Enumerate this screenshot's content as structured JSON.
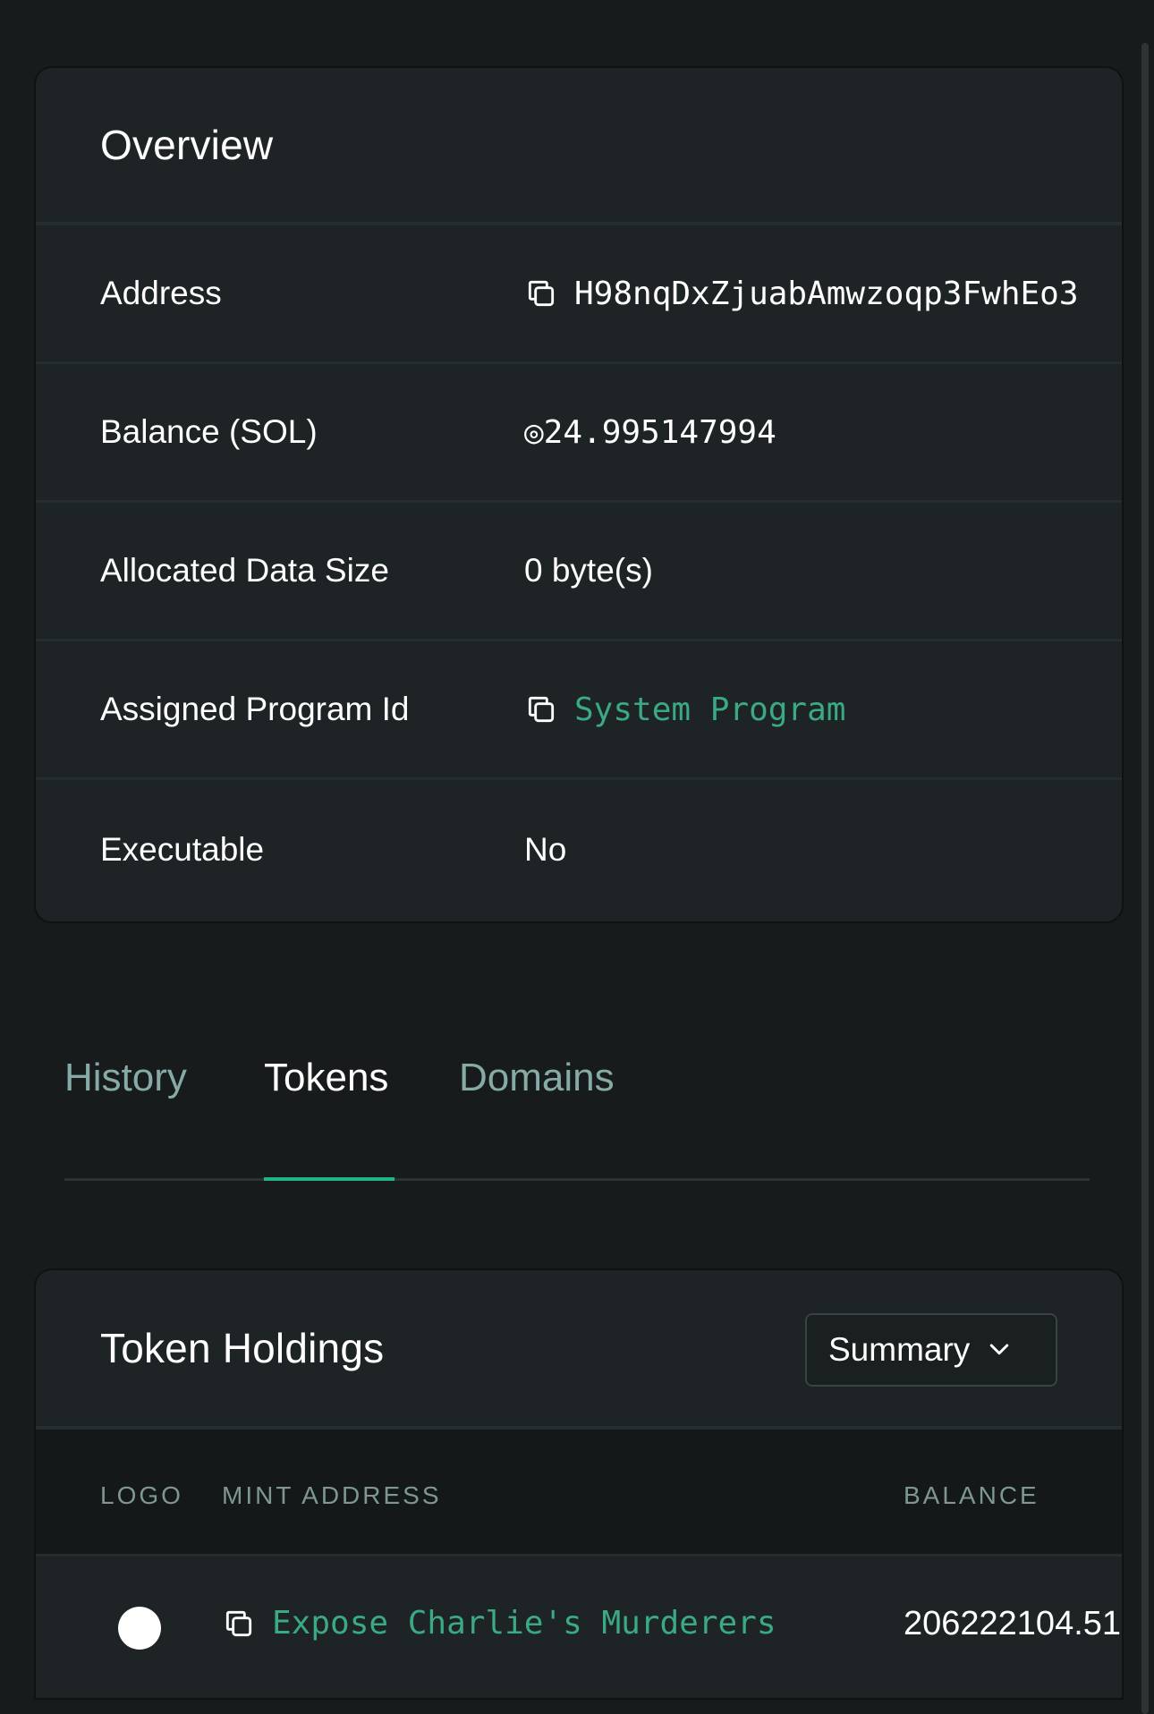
{
  "overview": {
    "title": "Overview",
    "rows": [
      {
        "label": "Address",
        "value": "H98nqDxZjuabAmwzoqp3FwhEo3"
      },
      {
        "label": "Balance (SOL)",
        "value": "◎24.995147994"
      },
      {
        "label": "Allocated Data Size",
        "value": "0 byte(s)"
      },
      {
        "label": "Assigned Program Id",
        "value": "System Program"
      },
      {
        "label": "Executable",
        "value": "No"
      }
    ]
  },
  "tabs": [
    {
      "label": "History",
      "active": false
    },
    {
      "label": "Tokens",
      "active": true
    },
    {
      "label": "Domains",
      "active": false
    }
  ],
  "tokens": {
    "title": "Token Holdings",
    "view_select": "Summary",
    "columns": [
      "LOGO",
      "MINT ADDRESS",
      "BALANCE"
    ],
    "rows": [
      {
        "mint": "Expose Charlie's Murderers",
        "balance": "206222104.51"
      }
    ]
  },
  "colors": {
    "accent": "#1fb48a",
    "link": "#3aa986",
    "inactive_tab": "#86aba7"
  }
}
